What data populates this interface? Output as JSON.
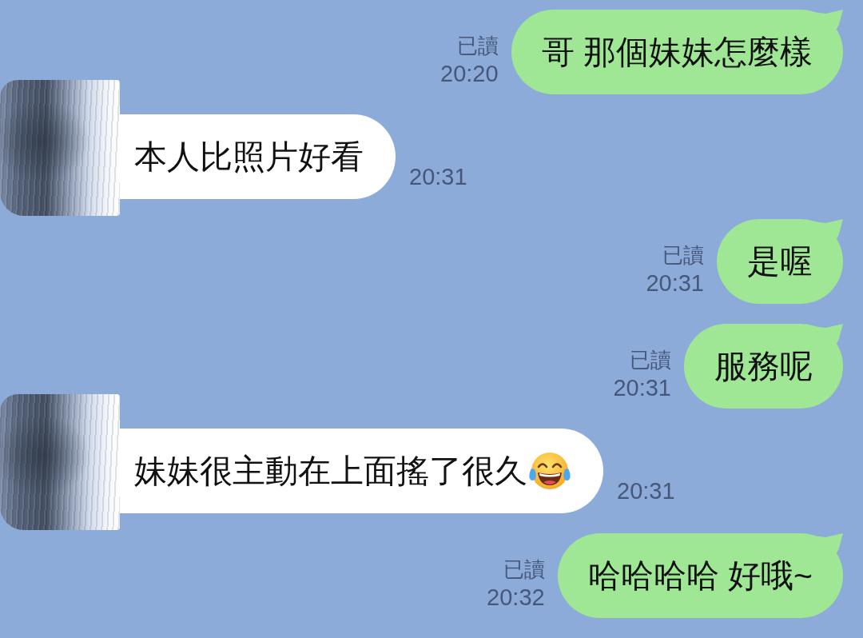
{
  "chat": {
    "messages": [
      {
        "kind": "sent",
        "text": "哥 那個妹妹怎麼樣",
        "read_label": "已讀",
        "time": "20:20",
        "emoji": false
      },
      {
        "kind": "received",
        "text": "本人比照片好看",
        "time": "20:31",
        "emoji": false
      },
      {
        "kind": "sent",
        "text": "是喔",
        "read_label": "已讀",
        "time": "20:31",
        "emoji": false
      },
      {
        "kind": "sent",
        "text": "服務呢",
        "read_label": "已讀",
        "time": "20:31",
        "emoji": false
      },
      {
        "kind": "received",
        "text": "妹妹很主動在上面搖了很久",
        "time": "20:31",
        "emoji": true
      },
      {
        "kind": "sent",
        "text": "哈哈哈哈 好哦~",
        "read_label": "已讀",
        "time": "20:32",
        "emoji": false
      }
    ]
  }
}
